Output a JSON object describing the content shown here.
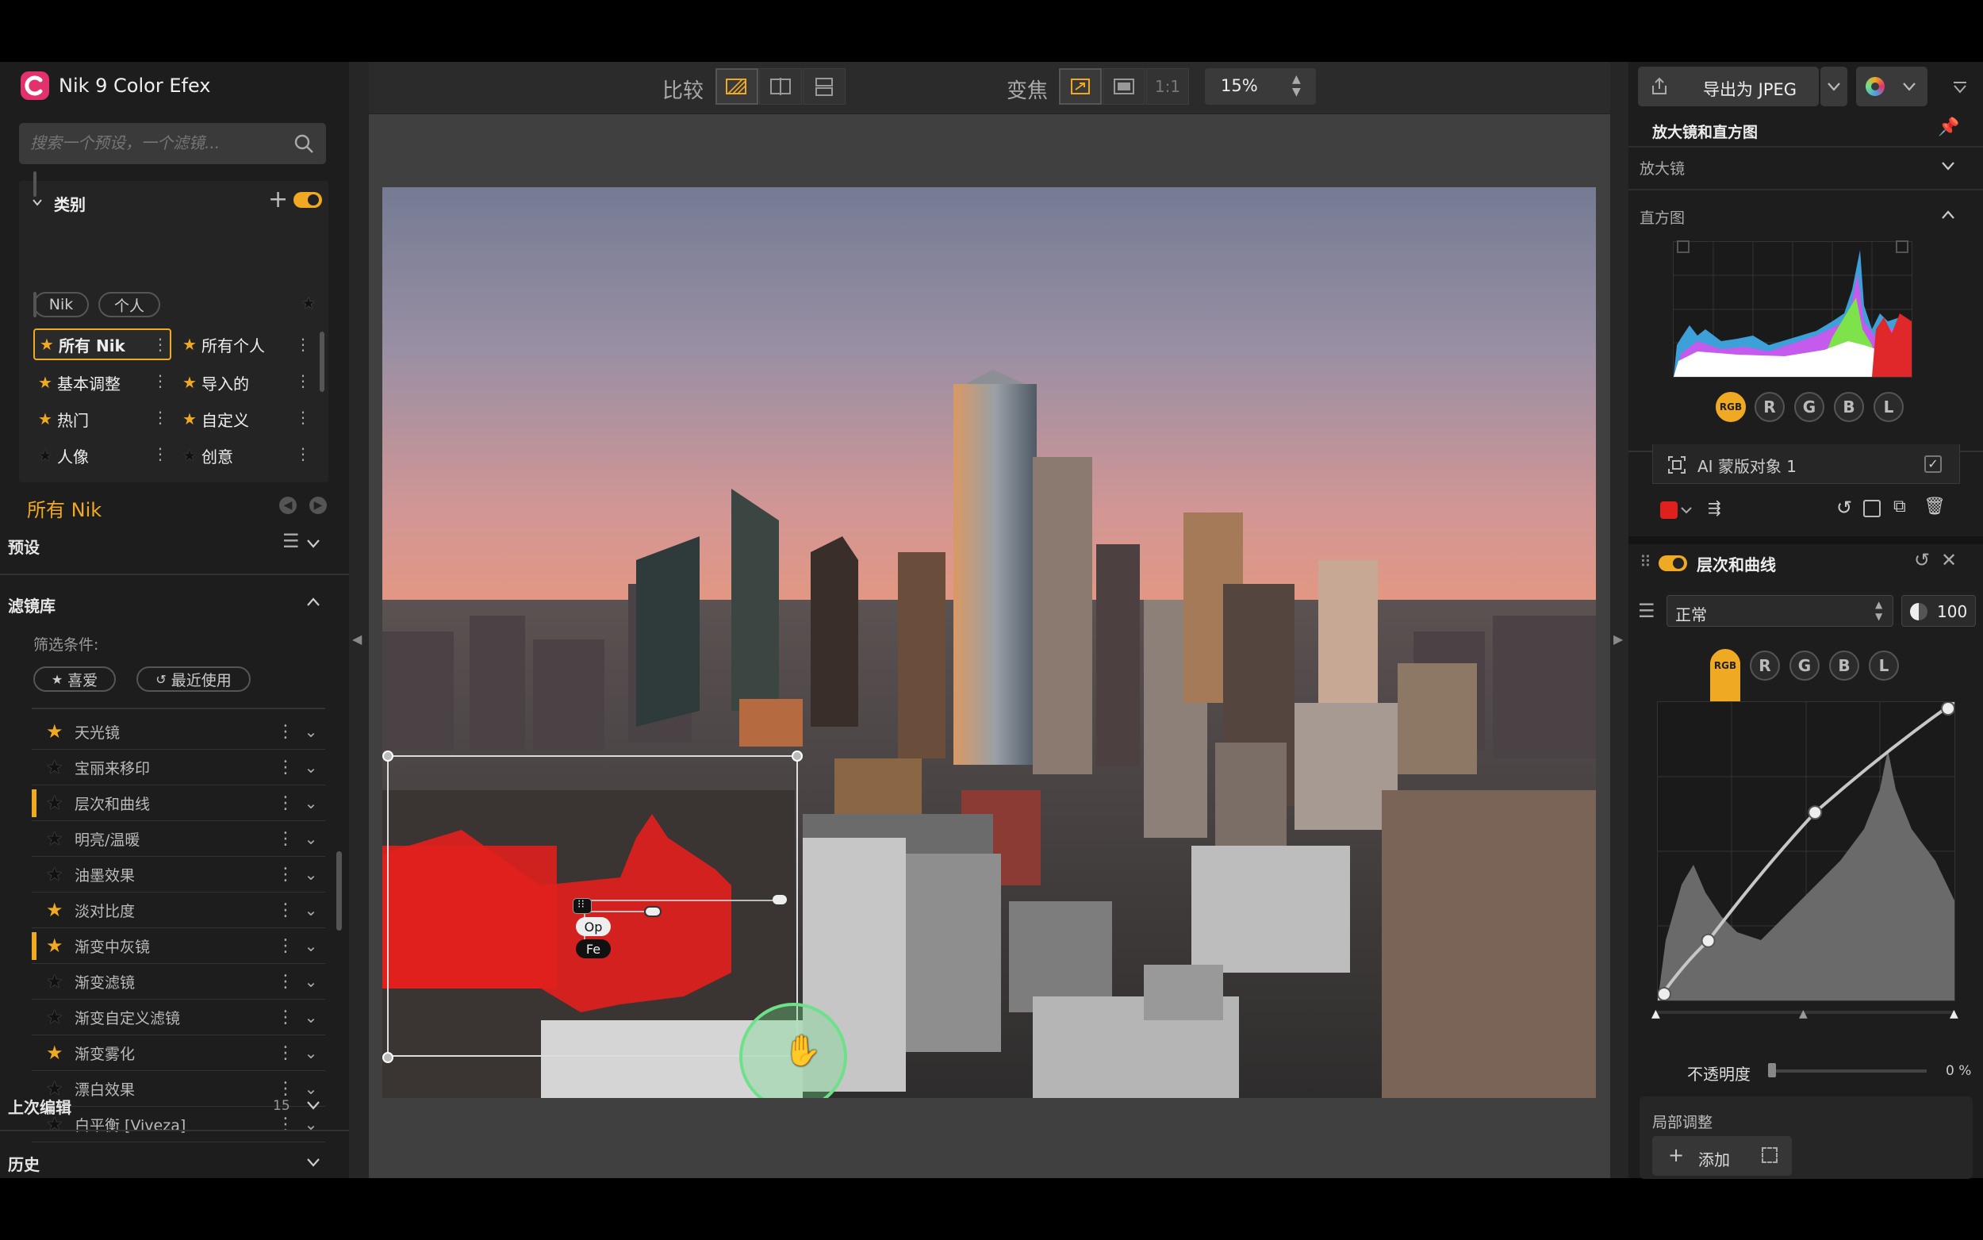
{
  "app": {
    "title": "Nik 9 Color Efex"
  },
  "search": {
    "placeholder": "搜索一个预设，一个滤镜..."
  },
  "categories": {
    "header": "类别",
    "pills": [
      "Nik",
      "个人"
    ],
    "items": [
      {
        "label": "所有 Nik",
        "starred": true,
        "selected": true
      },
      {
        "label": "所有个人",
        "starred": true
      },
      {
        "label": "基本调整",
        "starred": true
      },
      {
        "label": "导入的",
        "starred": true
      },
      {
        "label": "热门",
        "starred": true
      },
      {
        "label": "自定义",
        "starred": true
      },
      {
        "label": "人像",
        "starred": false
      },
      {
        "label": "创意",
        "starred": false
      }
    ]
  },
  "collection": {
    "title": "所有 Nik"
  },
  "presets": {
    "header": "预设"
  },
  "library": {
    "header": "滤镜库",
    "filter_label": "筛选条件:",
    "filter_pills": [
      "喜爱",
      "最近使用"
    ],
    "filters": [
      {
        "name": "天光镜",
        "starred": true,
        "active": false
      },
      {
        "name": "宝丽来移印",
        "starred": false,
        "active": false
      },
      {
        "name": "层次和曲线",
        "starred": false,
        "active": true
      },
      {
        "name": "明亮/温暖",
        "starred": false,
        "active": false
      },
      {
        "name": "油墨效果",
        "starred": false,
        "active": false
      },
      {
        "name": "淡对比度",
        "starred": true,
        "active": false
      },
      {
        "name": "渐变中灰镜",
        "starred": true,
        "active": true
      },
      {
        "name": "渐变滤镜",
        "starred": false,
        "active": false
      },
      {
        "name": "渐变自定义滤镜",
        "starred": false,
        "active": false
      },
      {
        "name": "渐变雾化",
        "starred": true,
        "active": false
      },
      {
        "name": "漂白效果",
        "starred": false,
        "active": false
      },
      {
        "name": "白平衡 [Viveza]",
        "starred": false,
        "active": false
      }
    ]
  },
  "last_edit": {
    "header": "上次编辑",
    "count": "15"
  },
  "history": {
    "header": "历史"
  },
  "toolbar": {
    "compare_label": "比较",
    "zoom_label": "变焦",
    "one_to_one": "1:1",
    "zoom_value": "15%"
  },
  "canvas": {
    "mask_labels": {
      "op": "Op",
      "fe": "Fe"
    }
  },
  "export": {
    "label": "导出为 JPEG"
  },
  "loupe_panel": {
    "title": "放大镜和直方图",
    "loupe_label": "放大镜",
    "histogram_label": "直方图"
  },
  "channels": [
    "RGB",
    "R",
    "G",
    "B",
    "L"
  ],
  "ai_mask": {
    "label": "AI 蒙版对象 1"
  },
  "curves": {
    "title": "层次和曲线",
    "blend_mode": "正常",
    "opacity_value": "100",
    "opacity_label": "不透明度",
    "opacity_percent": "0 %",
    "curve_points": [
      [
        0,
        0
      ],
      [
        0.17,
        0.2
      ],
      [
        0.53,
        0.63
      ],
      [
        1,
        1
      ]
    ]
  },
  "local": {
    "header": "局部调整",
    "add_label": "添加"
  },
  "colors": {
    "accent": "#f0a923",
    "mask": "#e0201c",
    "selected_border": "#f0a923"
  }
}
